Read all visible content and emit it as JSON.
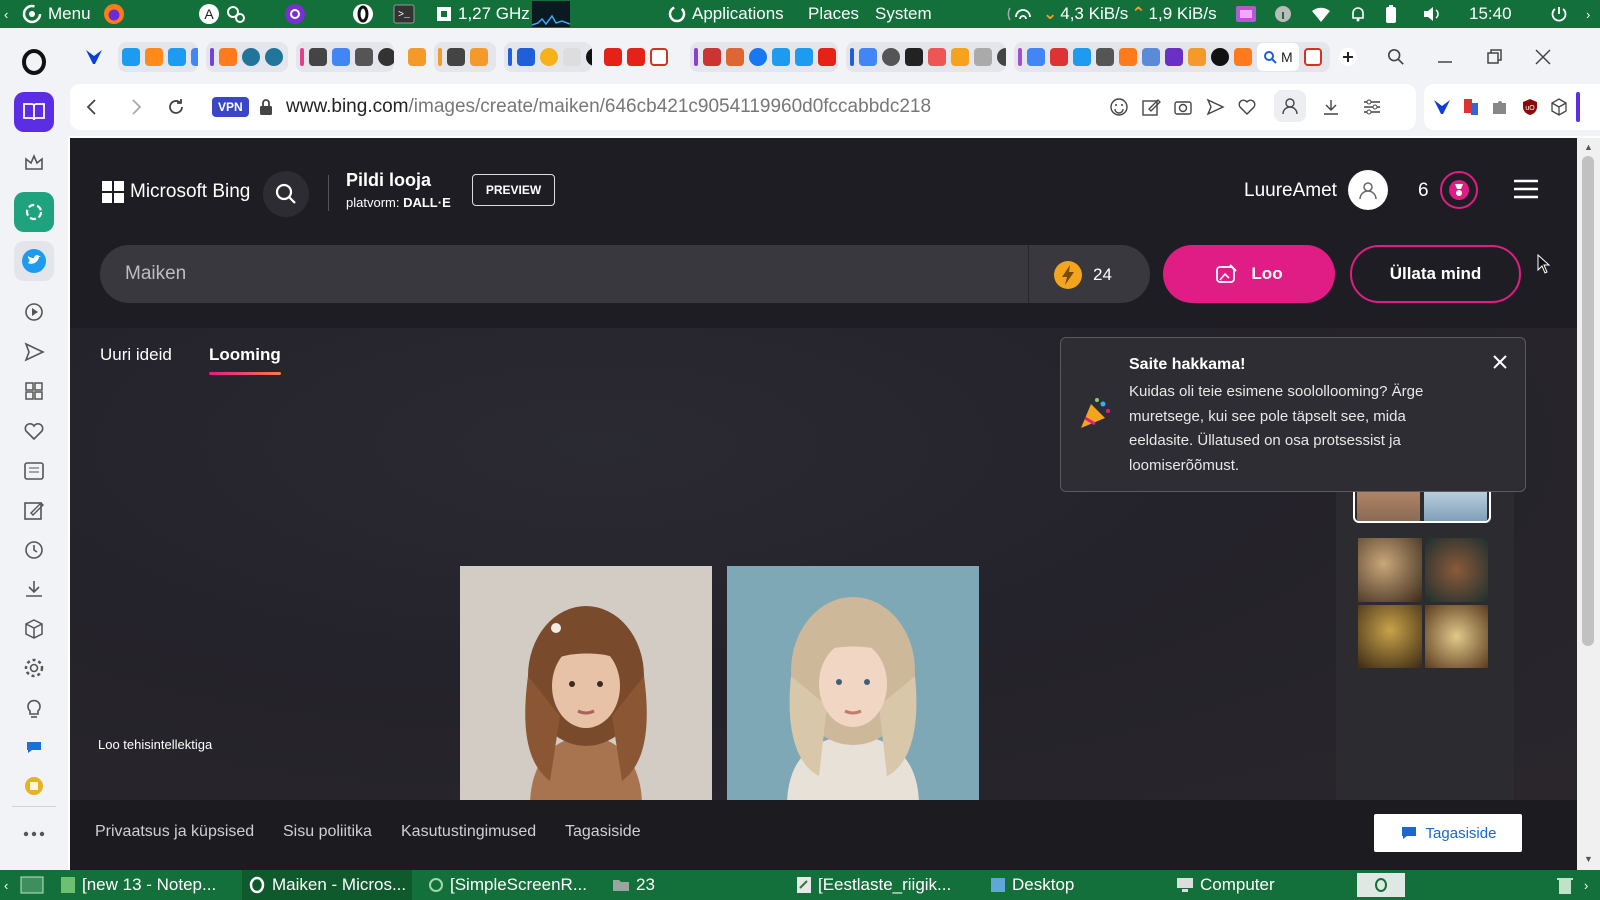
{
  "system_panel": {
    "menu_label": "Menu",
    "cpu_freq": "1,27 GHz",
    "applications": "Applications",
    "places": "Places",
    "system": "System",
    "net_down": "4,3 KiB/s",
    "net_up": "1,9 KiB/s",
    "clock": "15:40"
  },
  "browser": {
    "vpn_badge": "VPN",
    "url_host": "www.bing.com",
    "url_path": "/images/create/maiken/646cb421c9054119960d0fccabbdc218",
    "active_tab_letter": "M"
  },
  "bing": {
    "brand": "Microsoft Bing",
    "product_title": "Pildi looja",
    "platform_label": "platvorm:",
    "platform_value": "DALL·E",
    "preview_label": "PREVIEW",
    "username": "LuureAmet",
    "rewards_count": "6",
    "prompt_value": "Maiken",
    "boosts_count": "24",
    "create_button": "Loo",
    "surprise_button": "Üllata mind",
    "tabs": [
      {
        "label": "Uuri ideid"
      },
      {
        "label": "Looming"
      }
    ],
    "popup": {
      "title": "Saite hakkama!",
      "body": "Kuidas oli teie esimene soolollooming? Ärge muretsege, kui see pole täpselt see, mida eeldasite. Üllatused on osa protsessist ja loomiserõõmust."
    },
    "ai_note": "Loo tehisintellektiga",
    "footer_links": [
      {
        "label": "Privaatsus ja küpsised"
      },
      {
        "label": "Sisu poliitika"
      },
      {
        "label": "Kasutustingimused"
      },
      {
        "label": "Tagasiside"
      }
    ],
    "feedback_button": "Tagasiside"
  },
  "taskbar": {
    "items": [
      {
        "label": "[new 13 - Notep..."
      },
      {
        "label": "Maiken - Micros..."
      },
      {
        "label": "[SimpleScreenR..."
      },
      {
        "label": "23"
      },
      {
        "label": "[Eestlaste_riigik..."
      },
      {
        "label": "Desktop"
      },
      {
        "label": "Computer"
      }
    ]
  },
  "colors": {
    "accent_pink": "#e01d84",
    "panel_green": "#14703a",
    "page_dark": "#1f1d24",
    "opera_red": "#d51a1a"
  }
}
